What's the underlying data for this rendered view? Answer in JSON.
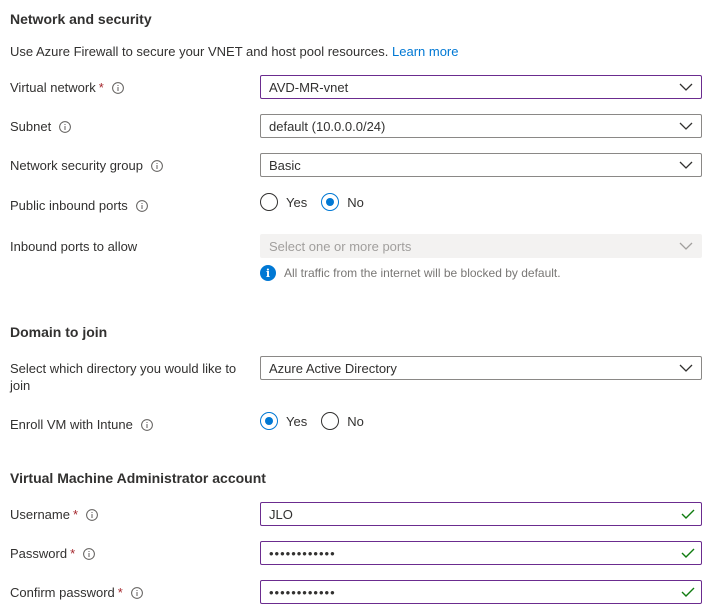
{
  "network": {
    "title": "Network and security",
    "description": "Use Azure Firewall to secure your VNET and host pool resources.",
    "learn_more": "Learn more",
    "virtual_network": {
      "label": "Virtual network",
      "value": "AVD-MR-vnet"
    },
    "subnet": {
      "label": "Subnet",
      "value": "default (10.0.0.0/24)"
    },
    "nsg": {
      "label": "Network security group",
      "value": "Basic"
    },
    "public_inbound": {
      "label": "Public inbound ports",
      "yes": "Yes",
      "no": "No",
      "selected": "No"
    },
    "inbound_ports": {
      "label": "Inbound ports to allow",
      "placeholder": "Select one or more ports",
      "note": "All traffic from the internet will be blocked by default."
    }
  },
  "domain": {
    "title": "Domain to join",
    "directory": {
      "label": "Select which directory you would like to join",
      "value": "Azure Active Directory"
    },
    "intune": {
      "label": "Enroll VM with Intune",
      "yes": "Yes",
      "no": "No",
      "selected": "Yes"
    }
  },
  "admin": {
    "title": "Virtual Machine Administrator account",
    "username": {
      "label": "Username",
      "value": "JLO"
    },
    "password": {
      "label": "Password",
      "value": "••••••••••••"
    },
    "confirm": {
      "label": "Confirm password",
      "value": "••••••••••••"
    }
  },
  "required_marker": "*",
  "colors": {
    "accent": "#0078d4",
    "required": "#a4262c",
    "focus_border": "#6b2c8f",
    "valid_check": "#107c10"
  }
}
